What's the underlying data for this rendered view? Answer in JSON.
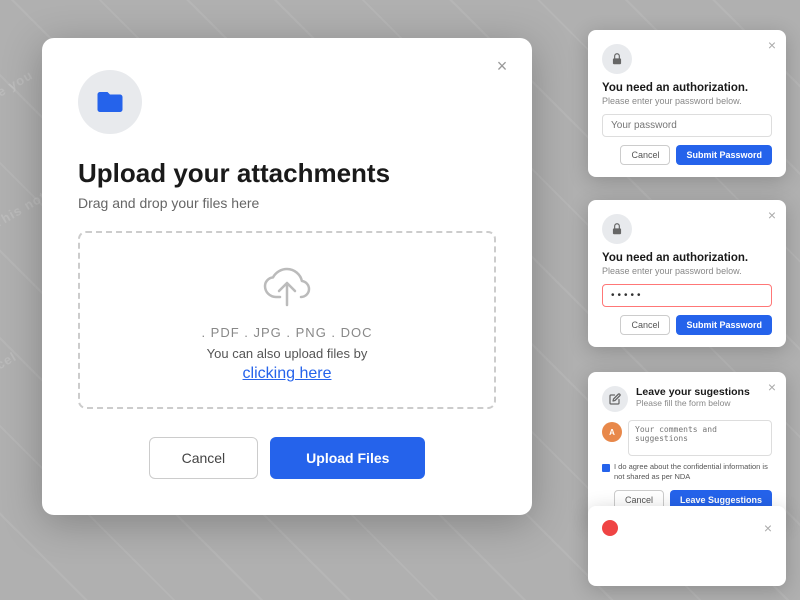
{
  "background": {
    "color": "#a8a8a8"
  },
  "main_modal": {
    "close_label": "×",
    "folder_icon": "📁",
    "title": "Upload your attachments",
    "subtitle": "Drag and drop your files here",
    "dropzone": {
      "file_types": ". PDF . JPG . PNG . DOC",
      "click_text": "You can also upload files by",
      "click_link": "clicking here"
    },
    "cancel_label": "Cancel",
    "upload_label": "Upload Files"
  },
  "auth_modal_1": {
    "close_label": "×",
    "title": "You need an authorization.",
    "subtitle": "Please enter your password below.",
    "input_placeholder": "Your password",
    "cancel_label": "Cancel",
    "submit_label": "Submit Password"
  },
  "auth_modal_2": {
    "close_label": "×",
    "title": "You need an authorization.",
    "subtitle": "Please enter your password below.",
    "input_value": "•••••",
    "cancel_label": "Cancel",
    "submit_label": "Submit Password"
  },
  "suggestion_modal": {
    "close_label": "×",
    "title": "Leave your sugestions",
    "subtitle": "Please fill the form below",
    "textarea_placeholder": "Your comments and suggestions",
    "avatar_initials": "A",
    "checkbox_label": "I do agree about the confidential information is not shared as per NDA",
    "cancel_label": "Cancel",
    "submit_label": "Leave Suggestions"
  },
  "bottom_modal": {
    "close_label": "×"
  }
}
